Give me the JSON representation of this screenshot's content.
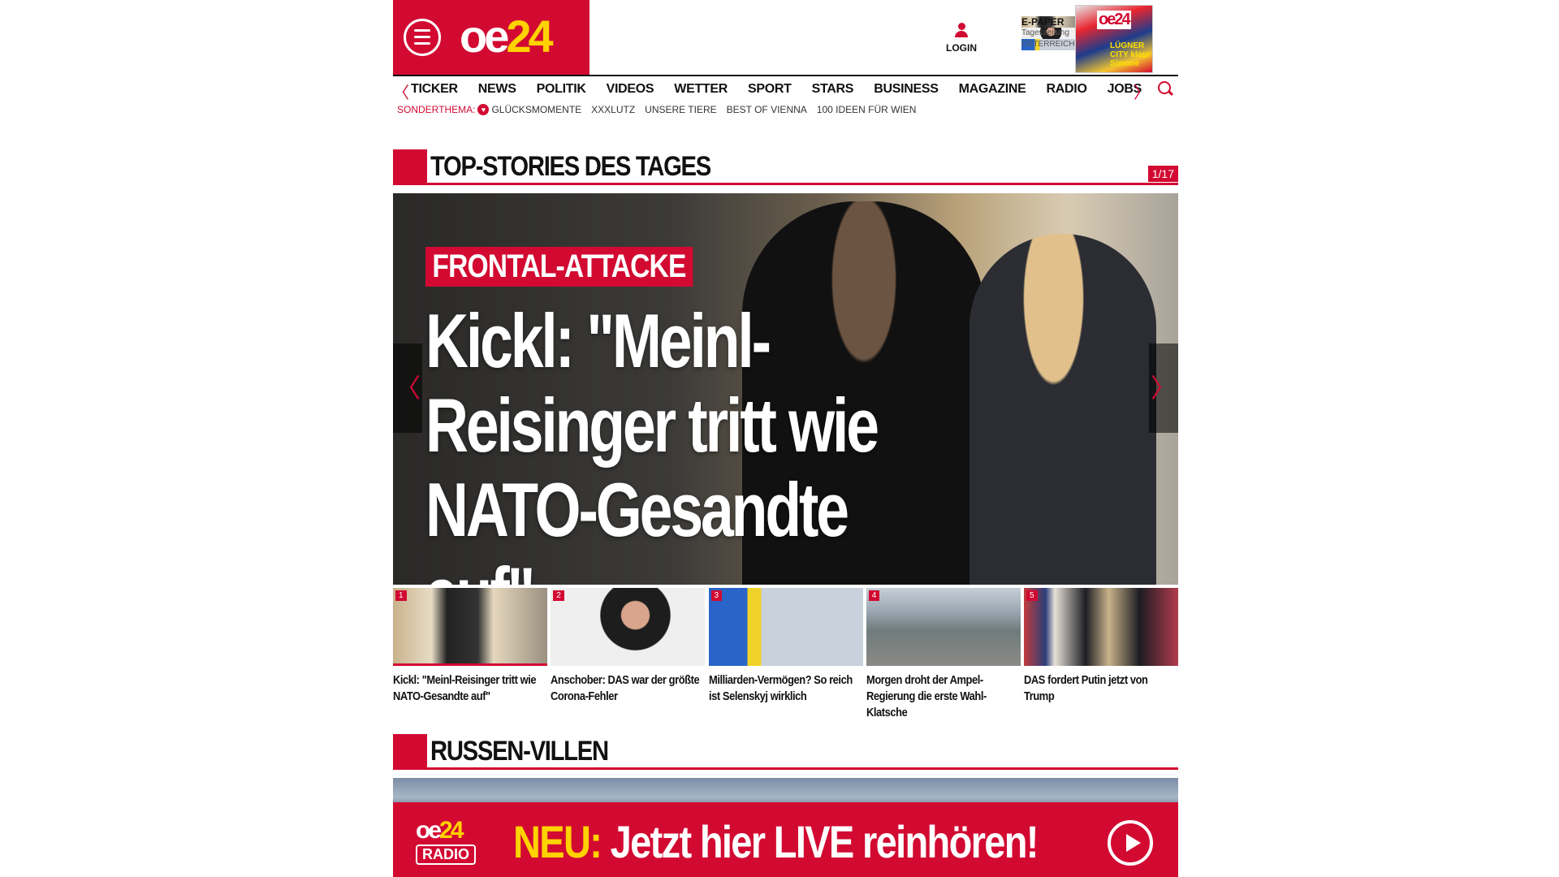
{
  "header": {
    "logo_text": "oe",
    "logo_num": "24",
    "login_label": "LOGIN",
    "epaper": {
      "title": "E-PAPER",
      "line2": "Tageszeitung",
      "line3": "ÖSTERREICH",
      "cover_title": "oe24",
      "cover_headline": "LÜGNER CITY klagt Simone"
    }
  },
  "nav": {
    "items": [
      "TICKER",
      "NEWS",
      "POLITIK",
      "VIDEOS",
      "WETTER",
      "SPORT",
      "STARS",
      "BUSINESS",
      "MAGAZINE",
      "RADIO",
      "JOBS"
    ],
    "left_arrow": "〈",
    "right_arrow": "〉"
  },
  "subnav": {
    "label": "SONDERTHEMA:",
    "items": [
      "GLÜCKSMOMENTE",
      "XXXLUTZ",
      "UNSERE TIERE",
      "BEST OF VIENNA",
      "100 IDEEN FÜR WIEN"
    ]
  },
  "top_stories": {
    "title": "TOP-STORIES DES TAGES",
    "counter": "1/17",
    "hero": {
      "kicker": "FRONTAL-ATTACKE",
      "headline": "Kickl: \"Meinl-Reisinger tritt wie NATO-Gesandte auf\"",
      "prev": "〈",
      "next": "〉"
    },
    "thumbs": [
      {
        "num": "1",
        "caption": "Kickl: \"Meinl-Reisinger tritt wie NATO-Gesandte auf\""
      },
      {
        "num": "2",
        "caption": "Anschober: DAS war der größte Corona-Fehler"
      },
      {
        "num": "3",
        "caption": "Milliarden-Vermögen? So reich ist Selenskyj wirklich"
      },
      {
        "num": "4",
        "caption": "Morgen droht der Ampel-Regierung die erste Wahl-Klatsche"
      },
      {
        "num": "5",
        "caption": "DAS fordert Putin jetzt von Trump"
      }
    ]
  },
  "russen": {
    "title": "RUSSEN-VILLEN"
  },
  "radio_banner": {
    "logo_text": "oe",
    "logo_num": "24",
    "logo_sub": "RADIO",
    "neu": "NEU:",
    "text": " Jetzt hier LIVE reinhören!"
  },
  "colors": {
    "brand_red": "#d20a32",
    "accent_yellow": "#ffd200"
  }
}
